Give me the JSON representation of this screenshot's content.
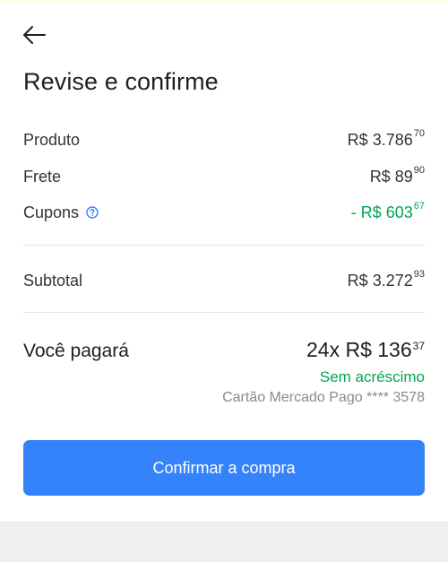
{
  "header": {
    "back_icon": "arrow-left-icon",
    "title": "Revise e confirme"
  },
  "summary": {
    "product": {
      "label": "Produto",
      "currency": "R$",
      "integer": "3.786",
      "cents": "70"
    },
    "shipping": {
      "label": "Frete",
      "currency": "R$",
      "integer": "89",
      "cents": "90"
    },
    "coupons": {
      "label": "Cupons",
      "help_icon": "question-circle-icon",
      "prefix": "- R$",
      "integer": "603",
      "cents": "67",
      "color": "#00a650"
    },
    "subtotal": {
      "label": "Subtotal",
      "currency": "R$",
      "integer": "3.272",
      "cents": "93"
    }
  },
  "payment": {
    "label": "Você pagará",
    "installments": "24x",
    "currency": "R$",
    "integer": "136",
    "cents": "37",
    "no_fee": "Sem acréscimo",
    "card": "Cartão Mercado Pago **** 3578"
  },
  "actions": {
    "confirm_label": "Confirmar a compra",
    "accent": "#3483fa"
  }
}
